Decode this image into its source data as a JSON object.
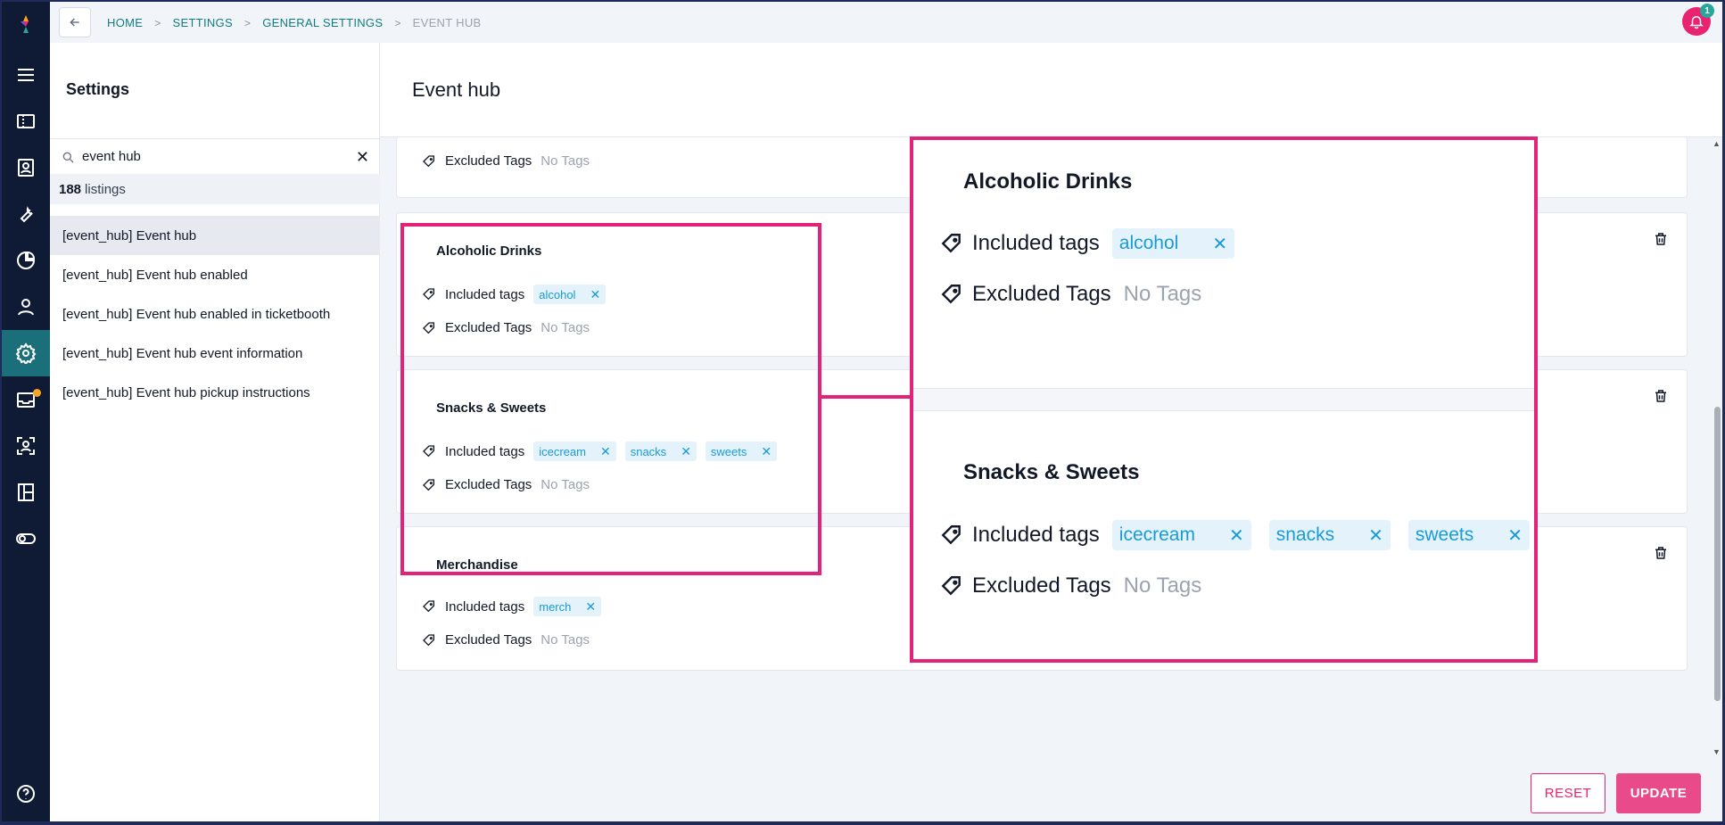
{
  "breadcrumbs": [
    "HOME",
    "SETTINGS",
    "GENERAL SETTINGS",
    "EVENT HUB"
  ],
  "notifications": {
    "count": "1"
  },
  "settings": {
    "title": "Settings",
    "search_value": "event hub",
    "listing_count": "188",
    "listing_suffix": "listings",
    "items": [
      "[event_hub] Event hub",
      "[event_hub] Event hub enabled",
      "[event_hub] Event hub enabled in ticketbooth",
      "[event_hub] Event hub event information",
      "[event_hub] Event hub pickup instructions"
    ]
  },
  "main": {
    "title": "Event hub",
    "included_label": "Included tags",
    "excluded_label": "Excluded Tags",
    "no_tags": "No Tags",
    "groups": [
      {
        "name": "Alcoholic Drinks",
        "included": [
          "alcohol"
        ]
      },
      {
        "name": "Snacks & Sweets",
        "included": [
          "icecream",
          "snacks",
          "sweets"
        ]
      },
      {
        "name": "Merchandise",
        "included": [
          "merch"
        ]
      }
    ]
  },
  "footer": {
    "reset": "RESET",
    "update": "UPDATE"
  },
  "colors": {
    "accent": "#e8236f",
    "teal": "#0f7d83",
    "rail": "#0f1b35",
    "chip_bg": "#e3f2fb",
    "chip_text": "#1a9ad6"
  }
}
